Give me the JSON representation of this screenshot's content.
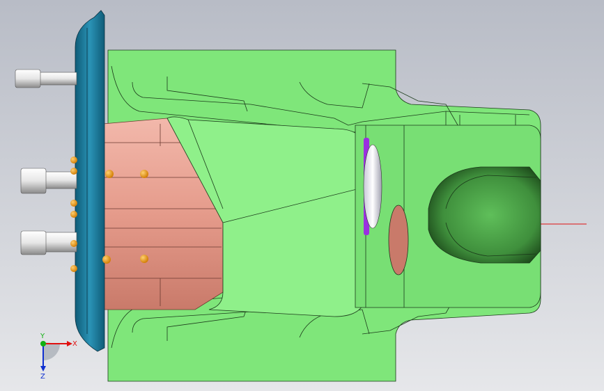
{
  "viewport": {
    "background_top": "#b8bcc6",
    "background_bottom": "#e6e7ea"
  },
  "triad": {
    "x_label": "X",
    "y_label": "Y",
    "z_label": "Z",
    "x_color": "#e01010",
    "y_color": "#10b010",
    "z_color": "#1030d0"
  },
  "model": {
    "body_color": "#7fe67a",
    "flange_color": "#1c7fa0",
    "contact_color": "#e8a69a",
    "pin_color": "#f0f0f0",
    "bead_color": "#f0a020",
    "seal_color": "#9a30e0",
    "reference_axis_color": "#e01010"
  }
}
